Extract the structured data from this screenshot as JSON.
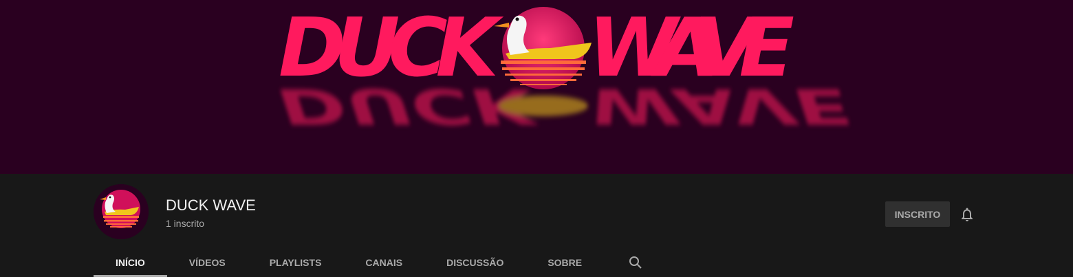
{
  "banner": {
    "title_left": "DUCK",
    "title_right": "WAVE",
    "colors": {
      "bg": "#2a0020",
      "title": "#ff1a5e",
      "sun": "#e0105a",
      "duck": "#f0c51c",
      "stripes": "#ff6a3a"
    }
  },
  "channel": {
    "name": "DUCK WAVE",
    "subscribers": "1 inscrito",
    "avatar_icon": "duck-sunset-logo"
  },
  "actions": {
    "subscribe_label": "INSCRITO",
    "bell_icon": "bell-icon"
  },
  "tabs": [
    {
      "label": "INÍCIO",
      "active": true
    },
    {
      "label": "VÍDEOS",
      "active": false
    },
    {
      "label": "PLAYLISTS",
      "active": false
    },
    {
      "label": "CANAIS",
      "active": false
    },
    {
      "label": "DISCUSSÃO",
      "active": false
    },
    {
      "label": "SOBRE",
      "active": false
    }
  ],
  "search_icon": "search-icon"
}
